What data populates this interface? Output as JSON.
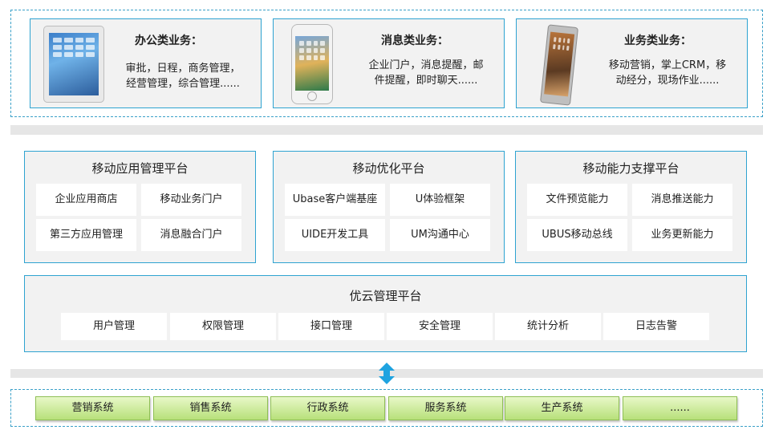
{
  "business": [
    {
      "title": "办公类业务：",
      "desc_line1": "审批，日程，商务管理，",
      "desc_line2": "经营管理，综合管理......",
      "device": "tablet-icon"
    },
    {
      "title": "消息类业务：",
      "desc_line1": "企业门户，消息提醒，邮",
      "desc_line2": "件提醒，即时聊天......",
      "device": "smartphone-icon"
    },
    {
      "title": "业务类业务：",
      "desc_line1": "移动营销，掌上CRM，移",
      "desc_line2": "动经分，现场作业......",
      "device": "android-phone-icon"
    }
  ],
  "platforms": [
    {
      "title": "移动应用管理平台",
      "items": [
        "企业应用商店",
        "移动业务门户",
        "第三方应用管理",
        "消息融合门户"
      ]
    },
    {
      "title": "移动优化平台",
      "items": [
        "Ubase客户端基座",
        "U体验框架",
        "UIDE开发工具",
        "UM沟通中心"
      ]
    },
    {
      "title": "移动能力支撑平台",
      "items": [
        "文件预览能力",
        "消息推送能力",
        "UBUS移动总线",
        "业务更新能力"
      ]
    }
  ],
  "cloud": {
    "title": "优云管理平台",
    "items": [
      "用户管理",
      "权限管理",
      "接口管理",
      "安全管理",
      "统计分析",
      "日志告警"
    ]
  },
  "systems": [
    "营销系统",
    "销售系统",
    "行政系统",
    "服务系统",
    "生产系统",
    "......"
  ],
  "colors": {
    "border": "#2ea3d1",
    "panel": "#f2f2f2",
    "arrow": "#1fa3e0",
    "system_button": "#c8ea94"
  }
}
